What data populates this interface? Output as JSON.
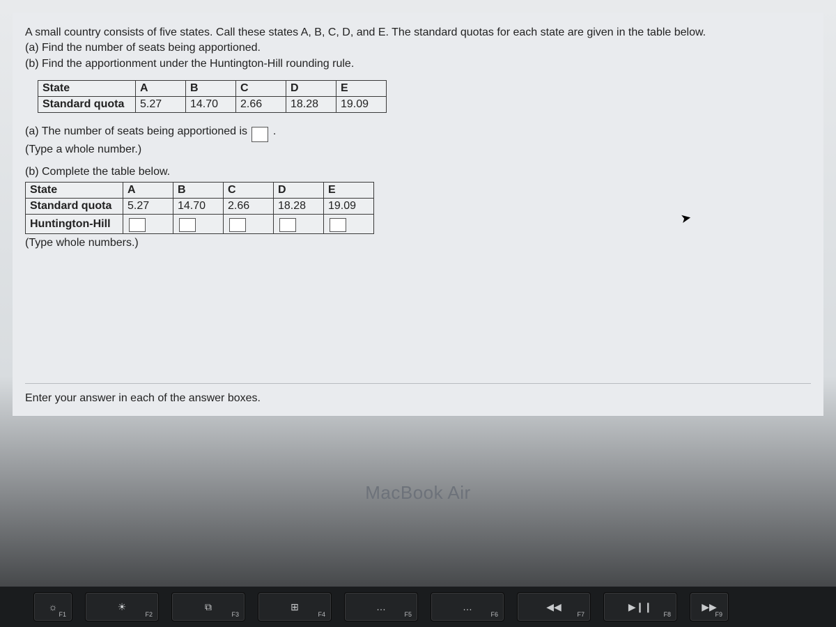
{
  "problem": {
    "intro": "A small country consists of five states. Call these states A, B, C, D, and E. The standard quotas for each state are given in the table below.",
    "part_a_question": "(a) Find the number of seats being apportioned.",
    "part_b_question": "(b) Find the apportionment under the Huntington-Hill rounding rule."
  },
  "table1": {
    "row_state_label": "State",
    "row_quota_label": "Standard quota",
    "states": [
      "A",
      "B",
      "C",
      "D",
      "E"
    ],
    "quotas": [
      "5.27",
      "14.70",
      "2.66",
      "18.28",
      "19.09"
    ]
  },
  "part_a": {
    "prompt_before": "(a) The number of seats being apportioned is",
    "prompt_after": ".",
    "hint": "(Type a whole number.)",
    "answer": ""
  },
  "part_b": {
    "prompt": "(b) Complete the table below.",
    "row_state_label": "State",
    "row_quota_label": "Standard quota",
    "row_hh_label": "Huntington-Hill",
    "states": [
      "A",
      "B",
      "C",
      "D",
      "E"
    ],
    "quotas": [
      "5.27",
      "14.70",
      "2.66",
      "18.28",
      "19.09"
    ],
    "hh_values": [
      "",
      "",
      "",
      "",
      ""
    ],
    "hint": "(Type whole numbers.)"
  },
  "footer": {
    "instruction": "Enter your answer in each of the answer boxes."
  },
  "hardware": {
    "brand": "MacBook Air",
    "keys": [
      {
        "icon": "☼",
        "label": "F1"
      },
      {
        "icon": "☀",
        "label": "F2"
      },
      {
        "icon": "⧉",
        "label": "F3"
      },
      {
        "icon": "⊞",
        "label": "F4"
      },
      {
        "icon": "…",
        "label": "F5"
      },
      {
        "icon": "…",
        "label": "F6"
      },
      {
        "icon": "◀◀",
        "label": "F7"
      },
      {
        "icon": "▶❙❙",
        "label": "F8"
      },
      {
        "icon": "▶▶",
        "label": "F9"
      }
    ]
  }
}
